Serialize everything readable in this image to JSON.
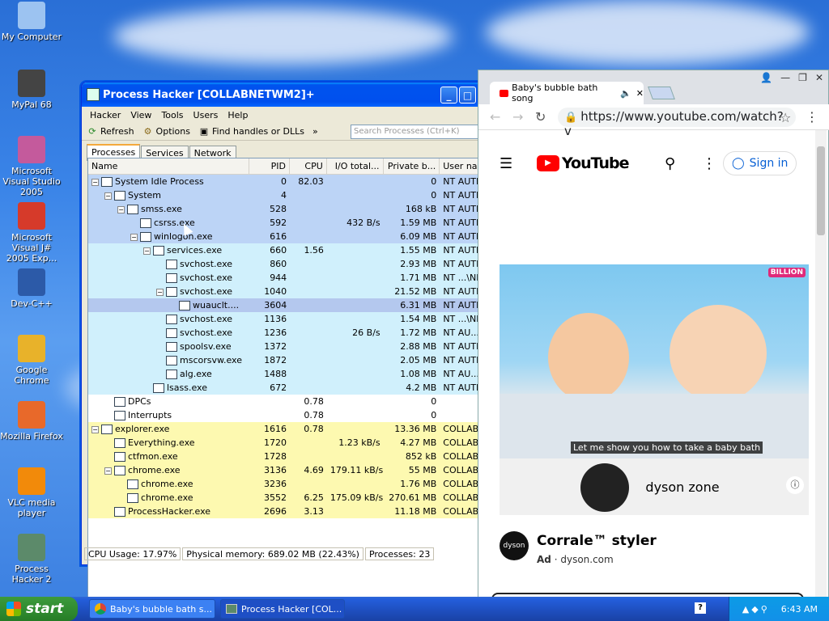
{
  "desktop": {
    "icons": [
      {
        "label": "My Computer",
        "color": "#9cc3f1"
      },
      {
        "label": "MyPal 68",
        "color": "#444444"
      },
      {
        "label": "Microsoft Visual Studio 2005",
        "color": "#c45a9c"
      },
      {
        "label": "Microsoft Visual J# 2005 Exp...",
        "color": "#d63a2a"
      },
      {
        "label": "Dev-C++",
        "color": "#2c5aa8"
      },
      {
        "label": "Google Chrome",
        "color": "#e8b22a"
      },
      {
        "label": "Mozilla Firefox",
        "color": "#e8692a"
      },
      {
        "label": "VLC media player",
        "color": "#f28a0a"
      },
      {
        "label": "Process Hacker 2",
        "color": "#5c8a6a"
      }
    ]
  },
  "process_hacker": {
    "title": "Process Hacker [COLLABNETWM2]+",
    "menu": [
      "Hacker",
      "View",
      "Tools",
      "Users",
      "Help"
    ],
    "toolbar": {
      "refresh": "Refresh",
      "options": "Options",
      "find": "Find handles or DLLs",
      "overflow": "»",
      "search_placeholder": "Search Processes (Ctrl+K)"
    },
    "tabs": [
      "Processes",
      "Services",
      "Network"
    ],
    "columns": [
      "Name",
      "PID",
      "CPU",
      "I/O total...",
      "Private b...",
      "User name"
    ],
    "rows": [
      {
        "indent": 0,
        "toggle": "−",
        "name": "System Idle Process",
        "pid": "0",
        "cpu": "82.03",
        "io": "",
        "priv": "0",
        "user": "NT AUTHOR",
        "bg": "sys"
      },
      {
        "indent": 1,
        "toggle": "−",
        "name": "System",
        "pid": "4",
        "cpu": "",
        "io": "",
        "priv": "0",
        "user": "NT AUTHOR",
        "bg": "sys"
      },
      {
        "indent": 2,
        "toggle": "−",
        "name": "smss.exe",
        "pid": "528",
        "cpu": "",
        "io": "",
        "priv": "168 kB",
        "user": "NT AUTHOR",
        "bg": "sys"
      },
      {
        "indent": 3,
        "toggle": "",
        "name": "csrss.exe",
        "pid": "592",
        "cpu": "",
        "io": "432 B/s",
        "priv": "1.59 MB",
        "user": "NT AUTHOR",
        "bg": "sys"
      },
      {
        "indent": 3,
        "toggle": "−",
        "name": "winlogon.exe",
        "pid": "616",
        "cpu": "",
        "io": "",
        "priv": "6.09 MB",
        "user": "NT AUTHOR",
        "bg": "sys"
      },
      {
        "indent": 4,
        "toggle": "−",
        "name": "services.exe",
        "pid": "660",
        "cpu": "1.56",
        "io": "",
        "priv": "1.55 MB",
        "user": "NT AUTHOR",
        "bg": "svc"
      },
      {
        "indent": 5,
        "toggle": "",
        "name": "svchost.exe",
        "pid": "860",
        "cpu": "",
        "io": "",
        "priv": "2.93 MB",
        "user": "NT AUTHOR",
        "bg": "svc"
      },
      {
        "indent": 5,
        "toggle": "",
        "name": "svchost.exe",
        "pid": "944",
        "cpu": "",
        "io": "",
        "priv": "1.71 MB",
        "user": "NT ...\\NETW",
        "bg": "svc"
      },
      {
        "indent": 5,
        "toggle": "−",
        "name": "svchost.exe",
        "pid": "1040",
        "cpu": "",
        "io": "",
        "priv": "21.52 MB",
        "user": "NT AUTHOR",
        "bg": "svc"
      },
      {
        "indent": 6,
        "toggle": "",
        "name": "wuauclt....",
        "pid": "3604",
        "cpu": "",
        "io": "",
        "priv": "6.31 MB",
        "user": "NT AUTHOR",
        "bg": "sel"
      },
      {
        "indent": 5,
        "toggle": "",
        "name": "svchost.exe",
        "pid": "1136",
        "cpu": "",
        "io": "",
        "priv": "1.54 MB",
        "user": "NT ...\\NETW",
        "bg": "svc"
      },
      {
        "indent": 5,
        "toggle": "",
        "name": "svchost.exe",
        "pid": "1236",
        "cpu": "",
        "io": "26 B/s",
        "priv": "1.72 MB",
        "user": "NT AU...\\LO",
        "bg": "svc"
      },
      {
        "indent": 5,
        "toggle": "",
        "name": "spoolsv.exe",
        "pid": "1372",
        "cpu": "",
        "io": "",
        "priv": "2.88 MB",
        "user": "NT AUTHOR",
        "bg": "svc"
      },
      {
        "indent": 5,
        "toggle": "",
        "name": "mscorsvw.exe",
        "pid": "1872",
        "cpu": "",
        "io": "",
        "priv": "2.05 MB",
        "user": "NT AUTHOR",
        "bg": "svc"
      },
      {
        "indent": 5,
        "toggle": "",
        "name": "alg.exe",
        "pid": "1488",
        "cpu": "",
        "io": "",
        "priv": "1.08 MB",
        "user": "NT AU...\\LO",
        "bg": "svc"
      },
      {
        "indent": 4,
        "toggle": "",
        "name": "lsass.exe",
        "pid": "672",
        "cpu": "",
        "io": "",
        "priv": "4.2 MB",
        "user": "NT AUTHOR",
        "bg": "svc"
      },
      {
        "indent": 1,
        "toggle": "",
        "name": "DPCs",
        "pid": "",
        "cpu": "0.78",
        "io": "",
        "priv": "0",
        "user": "",
        "bg": "none"
      },
      {
        "indent": 1,
        "toggle": "",
        "name": "Interrupts",
        "pid": "",
        "cpu": "0.78",
        "io": "",
        "priv": "0",
        "user": "",
        "bg": "none"
      },
      {
        "indent": 0,
        "toggle": "−",
        "name": "explorer.exe",
        "pid": "1616",
        "cpu": "0.78",
        "io": "",
        "priv": "13.36 MB",
        "user": "COLLABNET",
        "bg": "user"
      },
      {
        "indent": 1,
        "toggle": "",
        "name": "Everything.exe",
        "pid": "1720",
        "cpu": "",
        "io": "1.23 kB/s",
        "priv": "4.27 MB",
        "user": "COLLABNET",
        "bg": "user"
      },
      {
        "indent": 1,
        "toggle": "",
        "name": "ctfmon.exe",
        "pid": "1728",
        "cpu": "",
        "io": "",
        "priv": "852 kB",
        "user": "COLLABNET",
        "bg": "user"
      },
      {
        "indent": 1,
        "toggle": "−",
        "name": "chrome.exe",
        "pid": "3136",
        "cpu": "4.69",
        "io": "179.11 kB/s",
        "priv": "55 MB",
        "user": "COLLABNET",
        "bg": "user"
      },
      {
        "indent": 2,
        "toggle": "",
        "name": "chrome.exe",
        "pid": "3236",
        "cpu": "",
        "io": "",
        "priv": "1.76 MB",
        "user": "COLLABNET",
        "bg": "user"
      },
      {
        "indent": 2,
        "toggle": "",
        "name": "chrome.exe",
        "pid": "3552",
        "cpu": "6.25",
        "io": "175.09 kB/s",
        "priv": "270.61 MB",
        "user": "COLLABNET",
        "bg": "user"
      },
      {
        "indent": 1,
        "toggle": "",
        "name": "ProcessHacker.exe",
        "pid": "2696",
        "cpu": "3.13",
        "io": "",
        "priv": "11.18 MB",
        "user": "COLLABNET",
        "bg": "user"
      }
    ],
    "status": {
      "cpu": "CPU Usage: 17.97%",
      "mem": "Physical memory: 689.02 MB (22.43%)",
      "procs": "Processes: 23"
    }
  },
  "browser": {
    "tab_title": "Baby's bubble bath song",
    "url": "https://www.youtube.com/watch?v",
    "youtube": {
      "brand": "YouTube",
      "sign_in": "Sign in"
    },
    "video_caption": "Let me show you how to take a baby bath",
    "video_brand": "BILLION",
    "ad_brand": "dyson zone",
    "ad_logo": "dyson",
    "ad_title": "Corrale™ styler",
    "ad_label": "Ad",
    "ad_domain": "dyson.com"
  },
  "taskbar": {
    "start": "start",
    "items": [
      "Baby's bubble bath s...",
      "Process Hacker [COL..."
    ],
    "time": "6:43 AM"
  }
}
